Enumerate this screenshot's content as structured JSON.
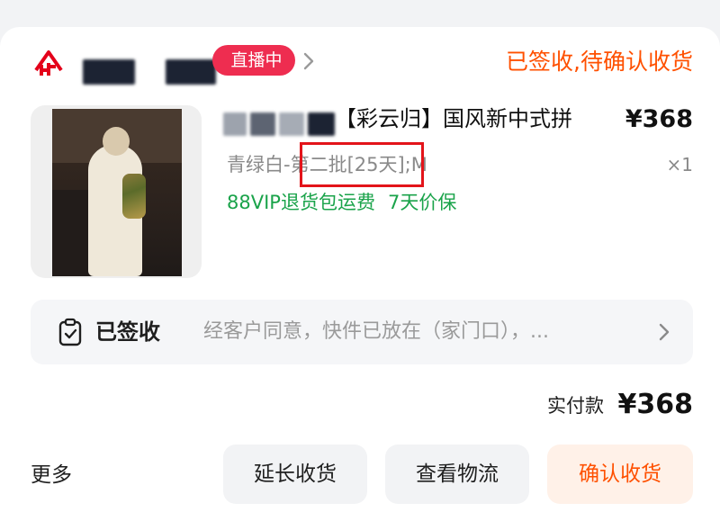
{
  "header": {
    "live_badge": "直播中",
    "order_status": "已签收,待确认收货"
  },
  "product": {
    "title": "【彩云归】国风新中式拼",
    "price": "¥368",
    "sku": "青绿白-第二批[25天];M",
    "quantity": "×1",
    "perks": [
      "88VIP退货包运费",
      "7天价保"
    ]
  },
  "delivery": {
    "status": "已签收",
    "detail": "经客户同意，快件已放在（家门口），..."
  },
  "payment": {
    "label": "实付款",
    "amount": "¥368"
  },
  "actions": {
    "more": "更多",
    "extend": "延长收货",
    "logistics": "查看物流",
    "confirm": "确认收货"
  },
  "colors": {
    "accent": "#ff5000",
    "live": "#ee2d50",
    "perk_green": "#1aa34a",
    "annotation": "#e3141a"
  },
  "icons": {
    "shop": "tmall-shop-icon",
    "chevron": "chevron-right-icon",
    "clipboard": "clipboard-check-icon"
  }
}
